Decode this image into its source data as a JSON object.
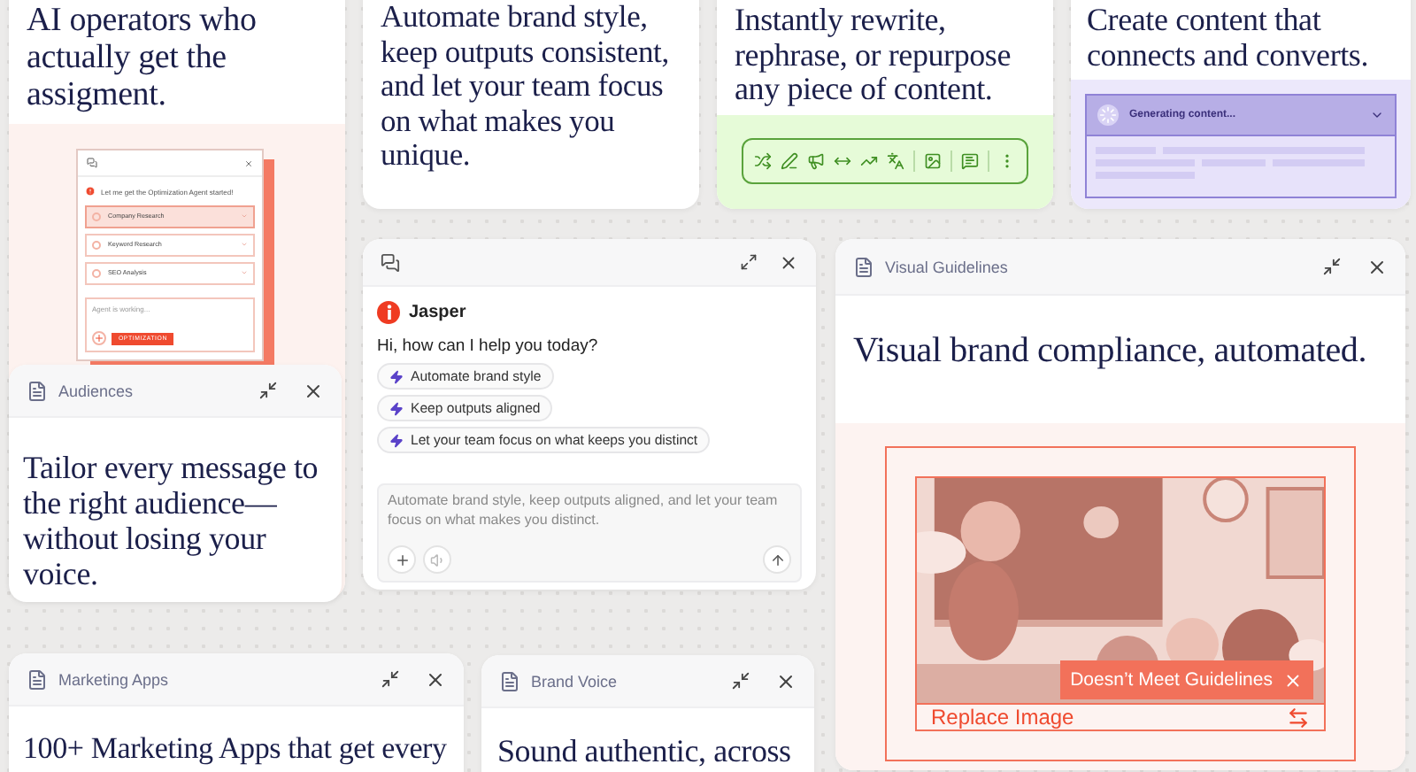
{
  "operators_card": {
    "headline": "AI operators who actually get the assigment.",
    "agent_window": {
      "message": "Let me get the Optimization Agent started!",
      "steps": [
        {
          "label": "Company Research",
          "selected": true
        },
        {
          "label": "Keyword Research",
          "selected": false
        },
        {
          "label": "SEO Analysis",
          "selected": false
        }
      ],
      "placeholder": "Agent is working...",
      "mode_tag": "OPTIMIZATION"
    }
  },
  "brand_style_card": {
    "headline": "Automate brand style, keep outputs consistent, and let your team focus on what makes you unique."
  },
  "rewrite_card": {
    "headline": "Instantly rewrite, rephrase, or repurpose any piece of content."
  },
  "content_card": {
    "headline": "Create content that connects and converts.",
    "status": "Generating content..."
  },
  "chat_window": {
    "assistant": "Jasper",
    "greeting": "Hi, how can I help you today?",
    "suggestions": [
      "Automate brand style",
      "Keep outputs aligned",
      "Let your team focus on what keeps you distinct"
    ],
    "placeholder": "Automate brand style, keep outputs aligned, and let your team focus on what makes you distinct."
  },
  "audiences_card": {
    "title": "Audiences",
    "headline": "Tailor every message to the right audience—without losing your voice."
  },
  "visual_card": {
    "title": "Visual Guidelines",
    "headline": "Visual brand compliance, automated.",
    "warning": "Doesn’t Meet Guidelines",
    "action": "Replace Image"
  },
  "marketing_card": {
    "title": "Marketing Apps",
    "headline": "100+ Marketing Apps that get every"
  },
  "brand_voice_card": {
    "title": "Brand Voice",
    "headline": "Sound authentic, across"
  }
}
